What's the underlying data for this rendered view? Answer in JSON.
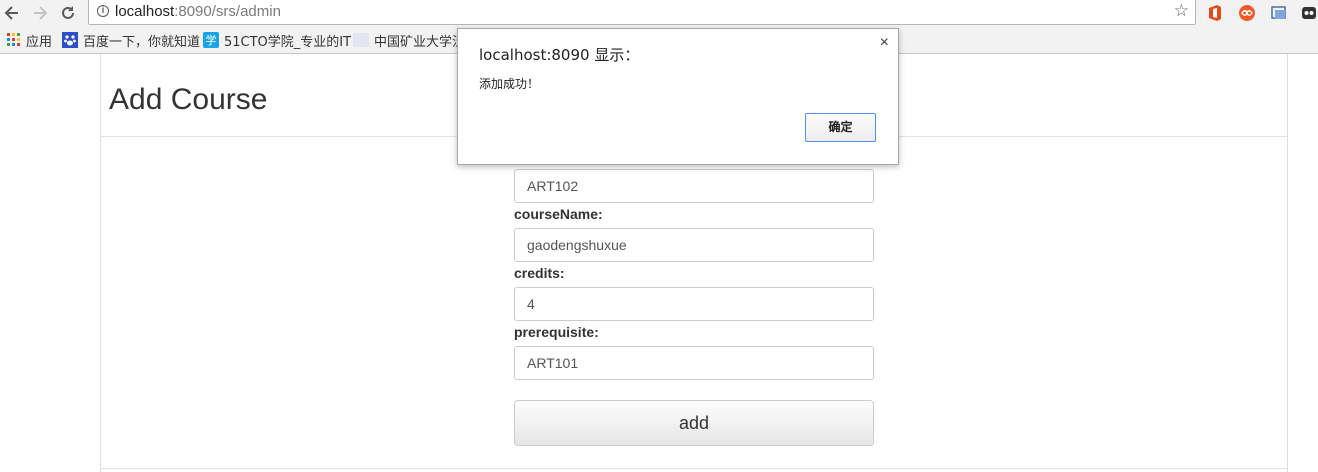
{
  "browser": {
    "url_host": "localhost",
    "url_rest": ":8090/srs/admin",
    "bookmarks": [
      {
        "label": "应用",
        "icon": "apps-grid-icon"
      },
      {
        "label": "百度一下，你就知道",
        "icon": "baidu-paw-icon"
      },
      {
        "label": "51CTO学院_专业的IT",
        "icon": "51cto-icon"
      },
      {
        "label": "中国矿业大学泛",
        "icon": "blank-page-icon"
      }
    ],
    "extension_icons": [
      "office-icon",
      "infinity-icon",
      "screenshot-icon",
      "ghost-icon"
    ]
  },
  "page": {
    "title": "Add Course",
    "fields": {
      "course_number_value": "ART102",
      "course_name_label": "courseName:",
      "course_name_value": "gaodengshuxue",
      "credits_label": "credits:",
      "credits_value": "4",
      "prerequisite_label": "prerequisite:",
      "prerequisite_value": "ART101"
    },
    "add_button_label": "add"
  },
  "dialog": {
    "title": "localhost:8090 显示：",
    "message": "添加成功！",
    "ok_label": "确定",
    "close_symbol": "×",
    "ok_border_color": "#4d90fe"
  }
}
